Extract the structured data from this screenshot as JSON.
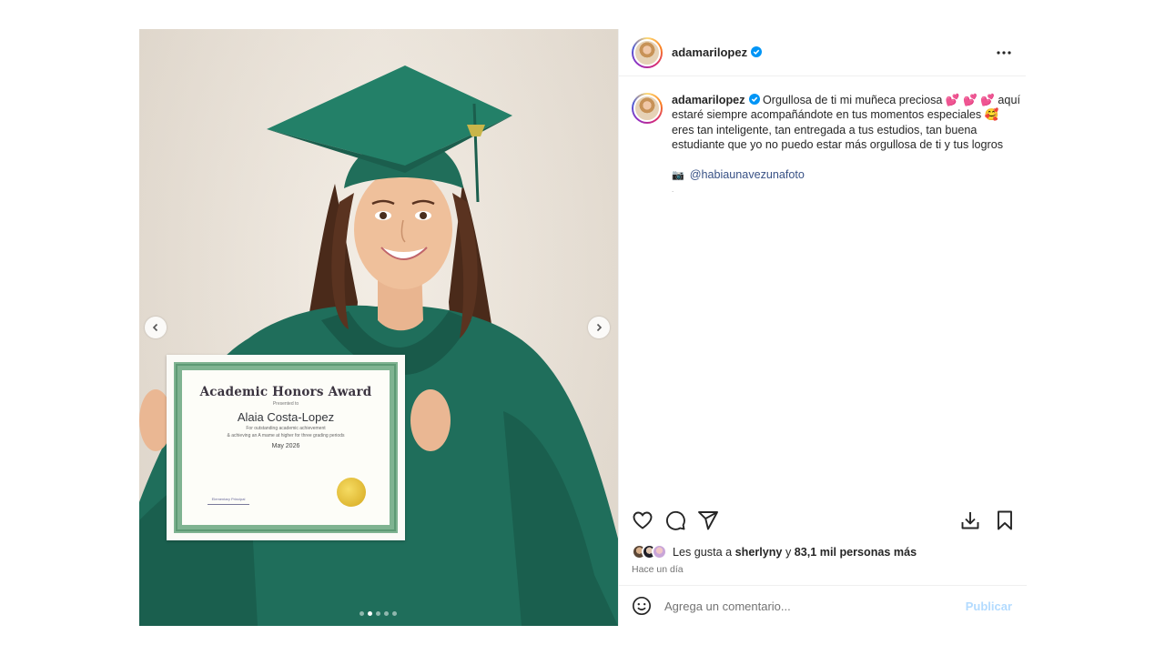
{
  "post": {
    "username": "adamarilopez",
    "caption_text": "Orgullosa de ti mi muñeca preciosa 💕 💕 💕 aquí estaré siempre acompañándote en tus momentos especiales 🥰 eres tan inteligente, tan entregada a tus estudios, tan buena estudiante que yo no puedo estar más orgullosa de ti y tus logros",
    "mention": "@habiaunavezunafoto",
    "camera_emoji": "📷",
    "likes_prefix": "Les gusta a",
    "likes_user": "sherlyny",
    "likes_joiner": "y",
    "likes_count": "83,1 mil personas más",
    "time": "Hace un día",
    "comment_placeholder": "Agrega un comentario...",
    "publish_label": "Publicar",
    "carousel": {
      "count": 5,
      "active": 1
    }
  },
  "certificate": {
    "title": "Academic Honors Award",
    "presented": "Presented to",
    "name": "Alaia Costa-Lopez",
    "line1": "For outstanding academic achievement",
    "line2": "& achieving an A mame at higher for three grading periods",
    "date": "May 2026",
    "signature_label": "Elementary Principal"
  },
  "icons": {
    "like": "heart-icon",
    "comment": "comment-icon",
    "share": "share-icon",
    "download": "download-icon",
    "save": "bookmark-icon",
    "more": "more-icon",
    "emoji": "emoji-icon",
    "verified": "verified-icon"
  },
  "colors": {
    "verified": "#0095f6",
    "gown": "#1f6e5b",
    "publish_disabled": "#b3dbff",
    "link": "#385185"
  }
}
